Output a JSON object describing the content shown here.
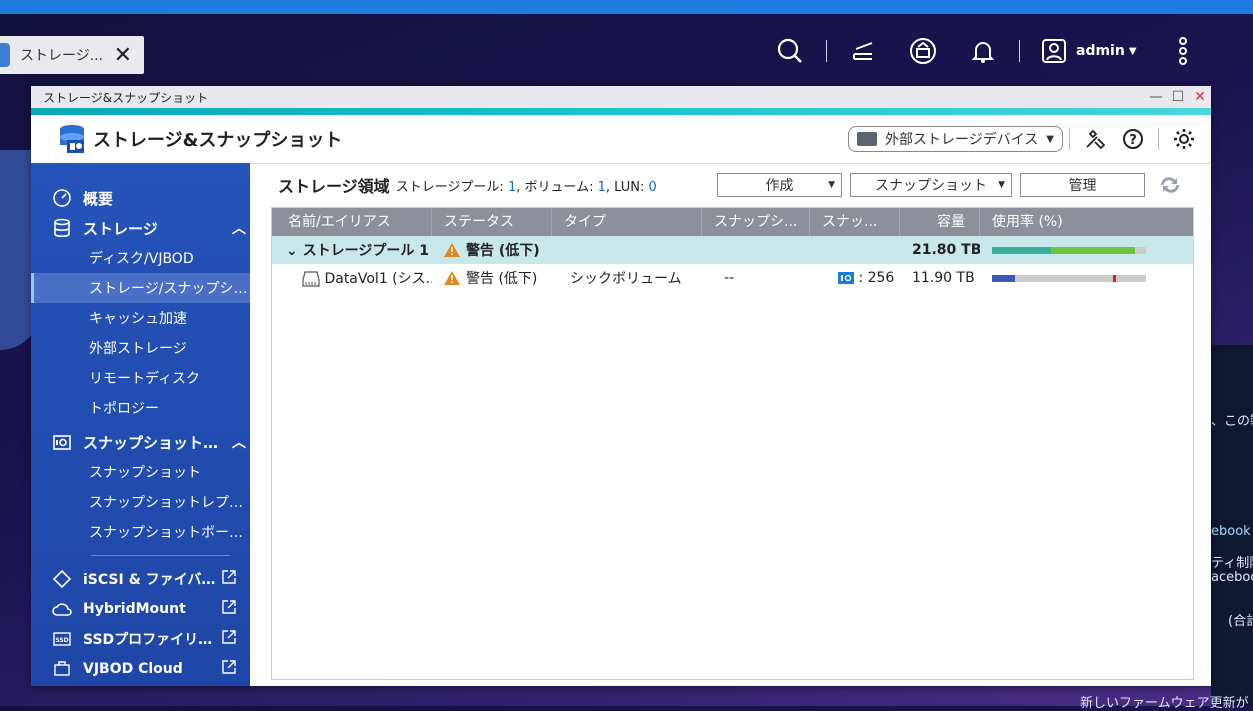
{
  "desktop": {
    "tab_label": "ストレージ...",
    "close_label": "✕",
    "user_name": "admin",
    "bg_texts": [
      "、この製",
      "ebook M",
      "ティ制限",
      "aceboo",
      "(合計",
      "新しいファームウェア更新が"
    ]
  },
  "window": {
    "title": "ストレージ&スナップショット",
    "minimize": "—",
    "maximize": "☐",
    "close": "✕"
  },
  "app": {
    "title": "ストレージ&スナップショット",
    "ext_device_label": "外部ストレージデバイス"
  },
  "sidebar": {
    "overview": "概要",
    "storage": "ストレージ",
    "storage_items": [
      "ディスク/VJBOD",
      "ストレージ/スナップショ...",
      "キャッシュ加速",
      "外部ストレージ",
      "リモートディスク",
      "トポロジー"
    ],
    "snapshot": "スナップショットバ...",
    "snapshot_items": [
      "スナップショット",
      "スナップショットレプリカ",
      "スナップショットボールト"
    ],
    "links": [
      "iSCSI & ファイバー...",
      "HybridMount",
      "SSDプロファイリン...",
      "VJBOD Cloud"
    ]
  },
  "toolbar": {
    "section_title": "ストレージ領域",
    "summary_pool_label": "ストレージプール:",
    "summary_pool_value": "1",
    "summary_volume_label": ", ボリューム:",
    "summary_volume_value": "1",
    "summary_lun_label": ", LUN:",
    "summary_lun_value": "0",
    "create": "作成",
    "snapshot": "スナップショット",
    "manage": "管理"
  },
  "table": {
    "headers": [
      "名前/エイリアス",
      "ステータス",
      "タイプ",
      "スナップシ...",
      "スナッ...",
      "容量",
      "使用率 (%)"
    ],
    "pool": {
      "name": "ストレージプール 1",
      "status": "警告 (低下)",
      "capacity": "21.80 TB",
      "usage_fraction": 0.93
    },
    "volume": {
      "name": "DataVol1 (シス...",
      "status": "警告 (低下)",
      "type": "シックボリューム",
      "snapshot": "--",
      "snap_count": ": 256",
      "capacity": "11.90 TB",
      "usage_fraction": 0.15
    }
  },
  "colors": {
    "sidebar": "#2553b8",
    "accent": "#1bc5c9",
    "warning": "#e08a1e",
    "link_number": "#1b64c8"
  }
}
